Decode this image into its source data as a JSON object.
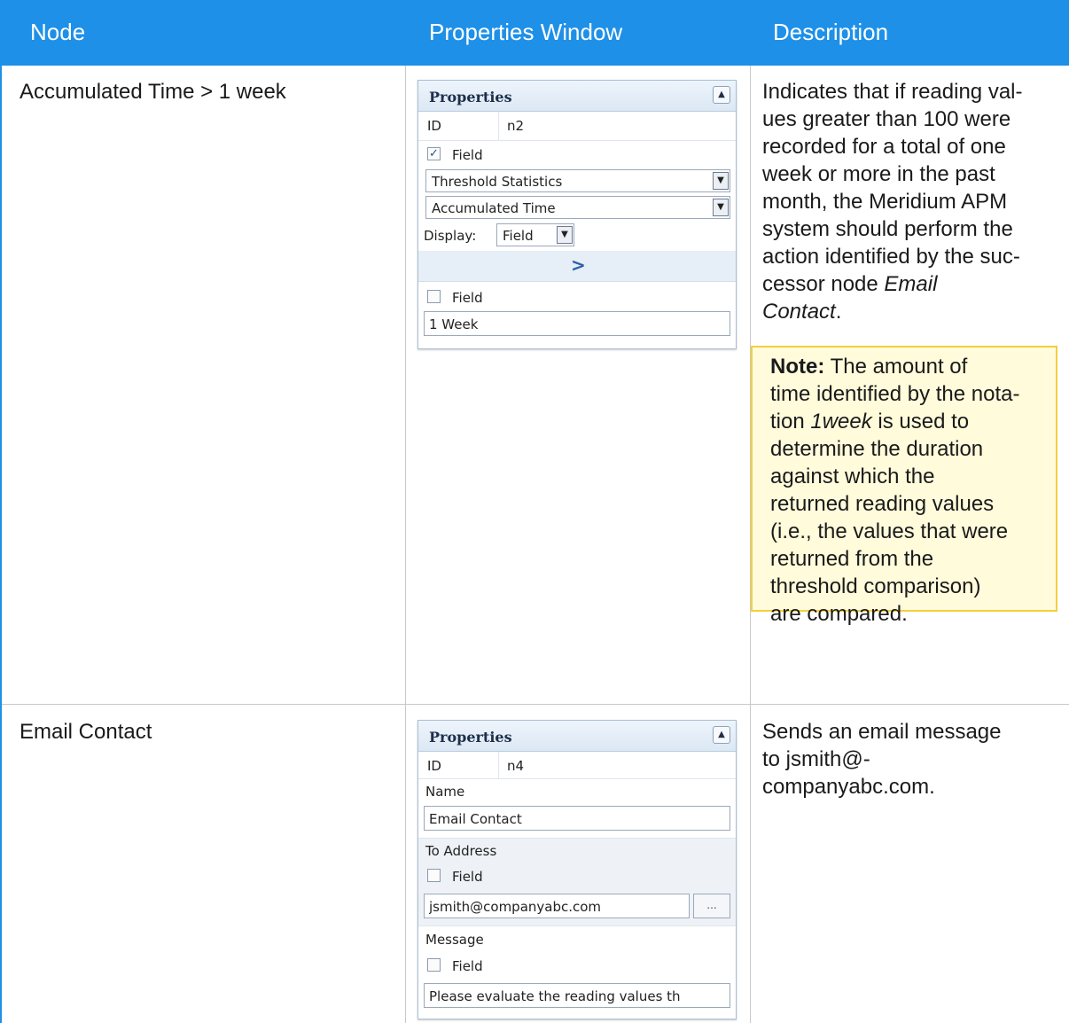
{
  "header": {
    "col_node": "Node",
    "col_properties": "Properties Window",
    "col_description": "Description"
  },
  "row1": {
    "node": "Accumulated Time > 1 week",
    "description_line1": "Indicates that if reading val-",
    "description_line2": "ues greater than 100 were",
    "description_line3": "recorded for a total of one",
    "description_line4": "week or more in the past",
    "description_line5": "month, the Meridium APM",
    "description_line6": "system should perform the",
    "description_line7": "action identified by the suc-",
    "description_line8": "cessor node ",
    "description_em1": "Email",
    "description_em2": "Contact",
    "description_end": ".",
    "note": {
      "label": "Note:",
      "line1": " The amount of",
      "line2": "time identified by the nota-",
      "line3a": "tion ",
      "line3_em": "1week",
      "line3b": " is used to",
      "line4": "determine the duration",
      "line5": "against which the",
      "line6": "returned reading values",
      "line7": "(i.e., the values that were",
      "line8": "returned from the",
      "line9": "threshold comparison)",
      "line10": "are compared."
    },
    "properties": {
      "title": "Properties",
      "id_label": "ID",
      "id_value": "n2",
      "field_checkbox_1": {
        "label": "Field",
        "checked": true
      },
      "dropdown_1": "Threshold Statistics",
      "dropdown_2": "Accumulated Time",
      "display_label": "Display:",
      "display_value": "Field",
      "operator": ">",
      "field_checkbox_2": {
        "label": "Field",
        "checked": false
      },
      "value_text": "1 Week"
    }
  },
  "row2": {
    "node": "Email Contact",
    "description_line1": "Sends an email message",
    "description_line2": "to jsmith@-",
    "description_line3": "companyabc.com.",
    "properties": {
      "title": "Properties",
      "id_label": "ID",
      "id_value": "n4",
      "name_label": "Name",
      "name_value": "Email Contact",
      "to_label": "To Address",
      "to_field_label": "Field",
      "to_value": "jsmith@companyabc.com",
      "ellipsis": "...",
      "message_label": "Message",
      "message_field_label": "Field",
      "message_value": "Please evaluate the reading values th"
    }
  },
  "colors": {
    "header_bg": "#1e90e8",
    "note_bg": "#fffbdb",
    "note_border": "#f2cf3f"
  }
}
